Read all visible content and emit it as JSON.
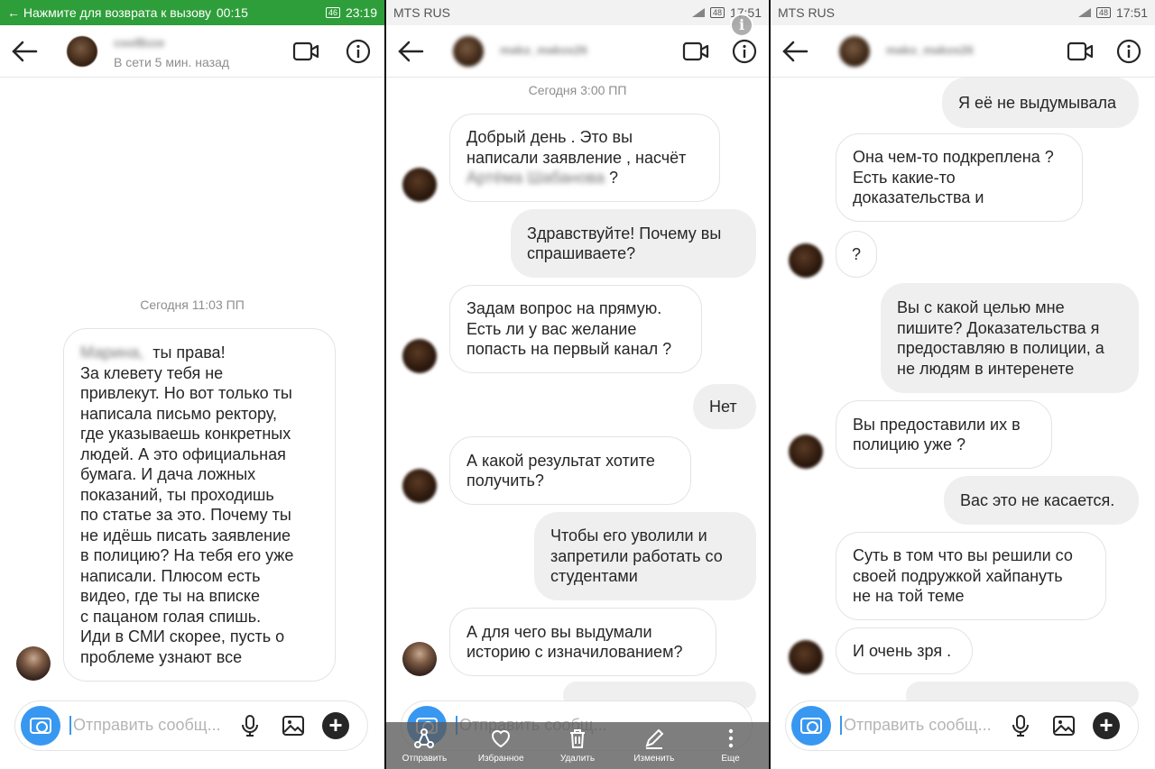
{
  "panel1": {
    "status": {
      "text": "← Нажмите для возврата к вызову",
      "timer": "00:15",
      "battery": "46",
      "time": "23:19"
    },
    "header": {
      "name": "coolBzze",
      "sub": "В сети 5 мин. назад"
    },
    "timestamp": "Сегодня 11:03 ПП",
    "message": {
      "blurred_name": "Марина,",
      "lines": [
        "ты права!",
        "За клевету тебя не",
        "привлекут.  Но вот только ты",
        "написала письмо ректору,",
        "где указываешь конкретных",
        "людей.  А это официальная",
        "бумага.  И дача ложных",
        "показаний,  ты проходишь",
        "по статье за это.  Почему ты",
        "не идёшь писать заявление",
        "в полицию? На тебя его уже",
        "написали. Плюсом есть",
        "видео, где ты на вписке",
        "с пацаном голая спишь.",
        "Иди в СМИ скорее,  пусть о",
        "проблеме узнают все"
      ]
    },
    "composer": {
      "placeholder": "Отправить сообщ..."
    }
  },
  "panel2": {
    "status": {
      "carrier": "MTS RUS",
      "battery": "48",
      "time": "17:51"
    },
    "header": {
      "name": "mako_makos26"
    },
    "timestamp": "Сегодня 3:00 ПП",
    "messages": [
      {
        "dir": "in",
        "lines": [
          "Добрый день . Это вы",
          "написали заявление , насчёт"
        ],
        "blurred": "Артёма Шабанова",
        "tail": "?"
      },
      {
        "dir": "out",
        "lines": [
          "Здравствуйте! Почему вы",
          "спрашиваете?"
        ]
      },
      {
        "dir": "in",
        "lines": [
          "Задам вопрос на прямую.",
          "Есть ли у вас желание",
          "попасть на первый канал ?"
        ]
      },
      {
        "dir": "out",
        "lines": [
          "Нет"
        ]
      },
      {
        "dir": "in",
        "lines": [
          "А какой результат хотите",
          "получить?"
        ]
      },
      {
        "dir": "out",
        "lines": [
          "Чтобы его уволили и",
          "запретили работать со",
          "студентами"
        ]
      },
      {
        "dir": "in",
        "lines": [
          "А для чего вы выдумали",
          "историю с изначилованием?"
        ]
      }
    ],
    "composer": {
      "placeholder": "Отправить сообщ..."
    },
    "selection_bar": [
      {
        "icon": "share-icon",
        "label": "Отправить"
      },
      {
        "icon": "heart-icon",
        "label": "Избранное"
      },
      {
        "icon": "trash-icon",
        "label": "Удалить"
      },
      {
        "icon": "edit-icon",
        "label": "Изменить"
      },
      {
        "icon": "more-icon",
        "label": "Еще"
      }
    ]
  },
  "panel3": {
    "status": {
      "carrier": "MTS RUS",
      "battery": "48",
      "time": "17:51"
    },
    "header": {
      "name": "mako_makos26"
    },
    "messages": [
      {
        "dir": "out",
        "lines": [
          "Я её не выдумывала"
        ]
      },
      {
        "dir": "in",
        "lines": [
          "Она чем-то подкреплена ?",
          "Есть какие-то",
          "доказательства и"
        ]
      },
      {
        "dir": "in",
        "lines": [
          "?"
        ]
      },
      {
        "dir": "out",
        "lines": [
          "Вы с какой целью мне",
          "пишите? Доказательства я",
          "предоставляю в полиции, а",
          "не людям в интеренете"
        ]
      },
      {
        "dir": "in",
        "lines": [
          "Вы предоставили их в",
          "полицию уже ?"
        ]
      },
      {
        "dir": "out",
        "lines": [
          "Вас это не касается."
        ]
      },
      {
        "dir": "in",
        "lines": [
          "Суть в том что вы решили со",
          "своей подружкой хайпануть",
          "не на той теме"
        ]
      },
      {
        "dir": "in",
        "lines": [
          "И очень зря ."
        ]
      }
    ],
    "composer": {
      "placeholder": "Отправить сообщ..."
    }
  },
  "colors": {
    "accent": "#3897f0",
    "call_green": "#2e9e3a",
    "bubble_out": "#efefef"
  }
}
